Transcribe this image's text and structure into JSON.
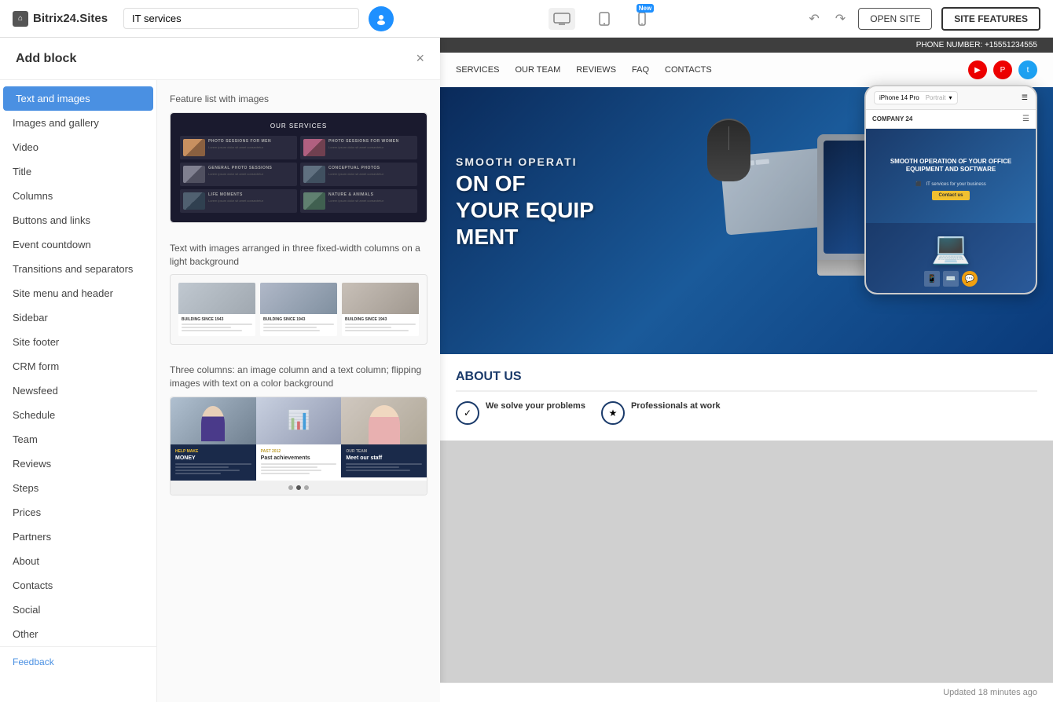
{
  "topbar": {
    "logo": "Bitrix24.Sites",
    "site_name": "IT services",
    "open_site_label": "OPEN SITE",
    "site_features_label": "SITE FEATURES",
    "new_badge": "New",
    "device_desktop": "desktop",
    "device_tablet": "tablet",
    "device_mobile": "mobile"
  },
  "panel": {
    "title": "Add block",
    "close_icon": "×",
    "nav_items": [
      {
        "id": "text-images",
        "label": "Text and images",
        "active": true
      },
      {
        "id": "images-gallery",
        "label": "Images and gallery"
      },
      {
        "id": "video",
        "label": "Video"
      },
      {
        "id": "title",
        "label": "Title"
      },
      {
        "id": "columns",
        "label": "Columns"
      },
      {
        "id": "buttons-links",
        "label": "Buttons and links"
      },
      {
        "id": "event-countdown",
        "label": "Event countdown"
      },
      {
        "id": "transitions",
        "label": "Transitions and separators"
      },
      {
        "id": "site-menu",
        "label": "Site menu and header"
      },
      {
        "id": "sidebar",
        "label": "Sidebar"
      },
      {
        "id": "site-footer",
        "label": "Site footer"
      },
      {
        "id": "crm-form",
        "label": "CRM form"
      },
      {
        "id": "newsfeed",
        "label": "Newsfeed"
      },
      {
        "id": "schedule",
        "label": "Schedule"
      },
      {
        "id": "team",
        "label": "Team"
      },
      {
        "id": "reviews",
        "label": "Reviews"
      },
      {
        "id": "steps",
        "label": "Steps"
      },
      {
        "id": "prices",
        "label": "Prices"
      },
      {
        "id": "partners",
        "label": "Partners"
      },
      {
        "id": "about",
        "label": "About"
      },
      {
        "id": "contacts",
        "label": "Contacts"
      },
      {
        "id": "social",
        "label": "Social"
      },
      {
        "id": "other",
        "label": "Other"
      }
    ],
    "feedback_label": "Feedback",
    "blocks": [
      {
        "id": "block1",
        "label": "Feature list with images"
      },
      {
        "id": "block2",
        "label": "Text with images arranged in three fixed-width columns on a light background"
      },
      {
        "id": "block3",
        "label": "Three columns: an image column and a text column; flipping images with text on a color background"
      }
    ]
  },
  "website": {
    "phone": "+15551234555",
    "nav_links": [
      "SERVICES",
      "OUR TEAM",
      "REVIEWS",
      "FAQ",
      "CONTACTS"
    ],
    "hero_text": "ON OF PMENT",
    "about_title": "ABOUT US",
    "about_stat1": "We solve your problems",
    "about_stat2": "Professionals at work",
    "status": "Updated 18 minutes ago",
    "mobile_device_label": "iPhone 14 Pro",
    "mobile_orientation": "Portrait",
    "mobile_company": "COMPANY 24",
    "mobile_hero_title": "SMOOTH OPERATION OF YOUR OFFICE EQUIPMENT AND SOFTWARE",
    "mobile_hero_subtitle": "IT services for your business",
    "mobile_cta": "Contact us"
  }
}
